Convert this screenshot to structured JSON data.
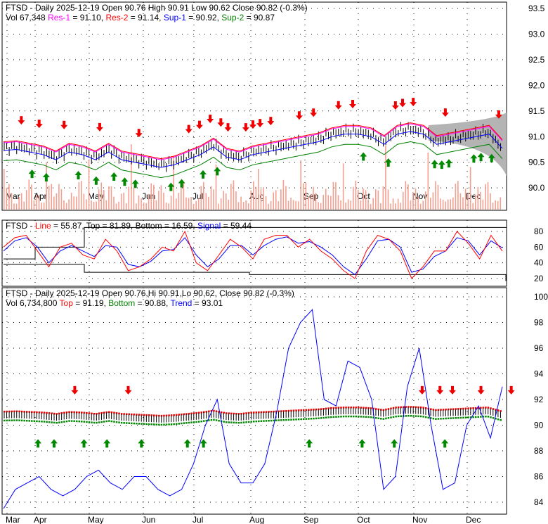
{
  "colors": {
    "up": "#000000",
    "res1": "#ff00ff",
    "res2": "#ff0000",
    "sup1": "#0000ff",
    "sup2": "#008000",
    "volume": "#f4a090",
    "cloud": "#b4b4b4"
  },
  "header1": {
    "a": "FTSD - Daily 2025-12-19 Open 90.76  High 90.91  Low 90.62  Close 90.82 (-0.3%)",
    "vol": "Vol 67,348 ",
    "res1": "Res-1",
    "res1v": " = 91.10, ",
    "res2": "Res-2",
    "res2v": " = 91.14, ",
    "sup1": "Sup-1",
    "sup1v": " = 90.92, ",
    "sup2": "Sup-2",
    "sup2v": " = 90.87"
  },
  "header2": {
    "a": "FTSD - ",
    "line": "Line",
    "linev": " = 55.87, Top = 81.89, Bottom = 16.59, ",
    "signal": "Signal",
    "signalv": " = 59.44"
  },
  "header3": {
    "a": "FTSD - Daily 2025-12-19 Open 90.76,Hi 90.91,Lo 90.62, Close 90.82 (-0.3%)",
    "vol": "Vol 6,734,800 ",
    "top": "Top",
    "topv": " = 91.19, ",
    "bottom": "Bottom",
    "bottomv": " = 90.88, ",
    "trend": "Trend",
    "trendv": " = 93.01"
  },
  "chart_data": [
    {
      "type": "candlestick",
      "title": "FTSD - Daily",
      "ylim": [
        89.7,
        93.6
      ],
      "yticks": [
        "93.5",
        "93.0",
        "92.5",
        "92.0",
        "91.5",
        "91.0",
        "90.5",
        "90.0"
      ],
      "months": [
        "Mar",
        "Apr",
        "May",
        "Jun",
        "Jul",
        "Aug",
        "Sep",
        "Oct",
        "Nov",
        "Dec"
      ],
      "weekly_close": [
        90.78,
        90.8,
        90.75,
        90.7,
        90.6,
        90.75,
        90.7,
        90.6,
        90.75,
        90.6,
        90.55,
        90.5,
        90.45,
        90.5,
        90.6,
        90.7,
        90.85,
        90.65,
        90.6,
        90.7,
        90.75,
        90.8,
        90.85,
        90.9,
        90.95,
        91.05,
        91.1,
        91.1,
        91.05,
        90.9,
        91.1,
        91.15,
        91.1,
        90.9,
        90.95,
        91.0,
        91.05,
        91.1,
        90.82
      ],
      "sell_arrows": [
        5,
        2.5,
        8.5,
        13.5,
        19,
        26,
        27.5,
        29,
        30.5,
        31.5,
        34,
        35,
        36,
        37.5,
        41.5,
        43.5,
        47,
        49,
        55,
        56,
        57.5,
        62,
        69.5
      ],
      "buy_arrows": [
        4,
        6,
        10.5,
        13,
        15.5,
        17,
        18.5,
        23.5,
        25,
        28,
        30,
        50.5,
        54,
        60.5,
        61.5,
        62.5,
        66,
        67,
        68.5
      ]
    },
    {
      "type": "line",
      "ylim": [
        12,
        88
      ],
      "yticks": [
        "80",
        "60",
        "40",
        "20"
      ],
      "line": [
        60,
        72,
        75,
        55,
        35,
        60,
        65,
        50,
        45,
        70,
        55,
        30,
        35,
        45,
        60,
        55,
        80,
        40,
        30,
        50,
        70,
        60,
        45,
        70,
        75,
        75,
        60,
        70,
        55,
        45,
        30,
        20,
        55,
        75,
        70,
        55,
        20,
        35,
        55,
        55,
        80,
        65,
        45,
        75,
        55
      ],
      "signal": [
        55,
        68,
        72,
        60,
        40,
        55,
        62,
        55,
        48,
        62,
        60,
        38,
        35,
        42,
        55,
        57,
        72,
        50,
        35,
        45,
        62,
        62,
        50,
        62,
        70,
        73,
        65,
        67,
        60,
        50,
        35,
        25,
        45,
        68,
        70,
        60,
        28,
        32,
        48,
        55,
        72,
        68,
        50,
        68,
        59
      ]
    },
    {
      "type": "line",
      "ylim": [
        83,
        100.5
      ],
      "yticks": [
        "100",
        "98",
        "96",
        "94",
        "92",
        "90",
        "88",
        "86",
        "84"
      ],
      "trend": [
        83.5,
        85,
        85.5,
        86,
        85,
        84.5,
        85,
        86,
        86.5,
        85.5,
        85,
        86,
        86,
        85,
        84.5,
        85,
        87,
        90,
        92,
        87,
        85.5,
        85.5,
        87,
        91,
        96,
        98,
        99,
        92,
        91.5,
        95,
        94.5,
        92,
        85,
        86,
        93,
        96,
        90,
        85,
        85.5,
        90,
        91.5,
        89,
        93
      ]
    }
  ]
}
